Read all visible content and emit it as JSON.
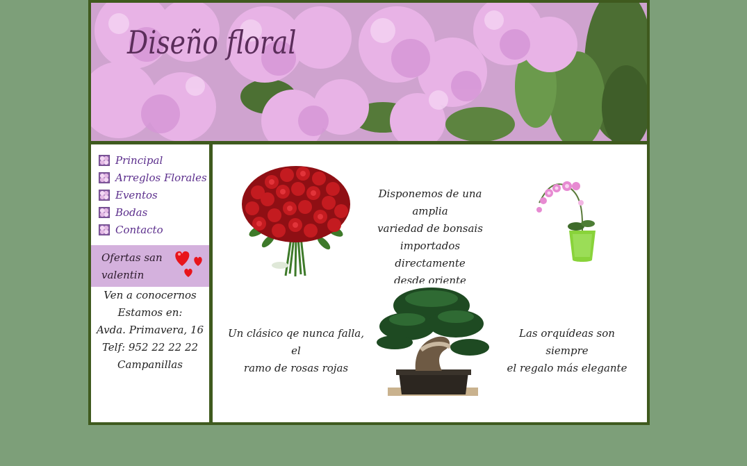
{
  "header": {
    "title": "Diseño floral"
  },
  "nav": {
    "items": [
      {
        "label": "Principal",
        "icon": "flower-bullet-icon"
      },
      {
        "label": "Arreglos Florales",
        "icon": "flower-bullet-icon"
      },
      {
        "label": "Eventos",
        "icon": "flower-bullet-icon"
      },
      {
        "label": "Bodas",
        "icon": "flower-bullet-icon"
      },
      {
        "label": "Contacto",
        "icon": "flower-bullet-icon"
      }
    ]
  },
  "offer": {
    "line1": "Ofertas san",
    "line2": "valentin",
    "icon": "hearts-icon"
  },
  "contact": {
    "line1": "Ven a conocernos",
    "line2": "Estamos en:",
    "line3": "Avda. Primavera, 16",
    "line4": "Telf: 952 22 22 22",
    "line5": "Campanillas"
  },
  "content": {
    "bonsai_text": {
      "l1": "Disponemos de una amplia",
      "l2": "variedad de bonsais",
      "l3": "importados directamente",
      "l4": "desde oriente"
    },
    "roses_text": {
      "l1": "Un clásico qe nunca falla, el",
      "l2": "ramo de rosas rojas"
    },
    "orchid_text": {
      "l1": "Las orquídeas son siempre",
      "l2": "el regalo más elegante"
    }
  },
  "colors": {
    "page_bg": "#7d9f79",
    "frame": "#3f5a1e",
    "link": "#5b2e8c",
    "offer_bg": "#d4b1dd"
  }
}
